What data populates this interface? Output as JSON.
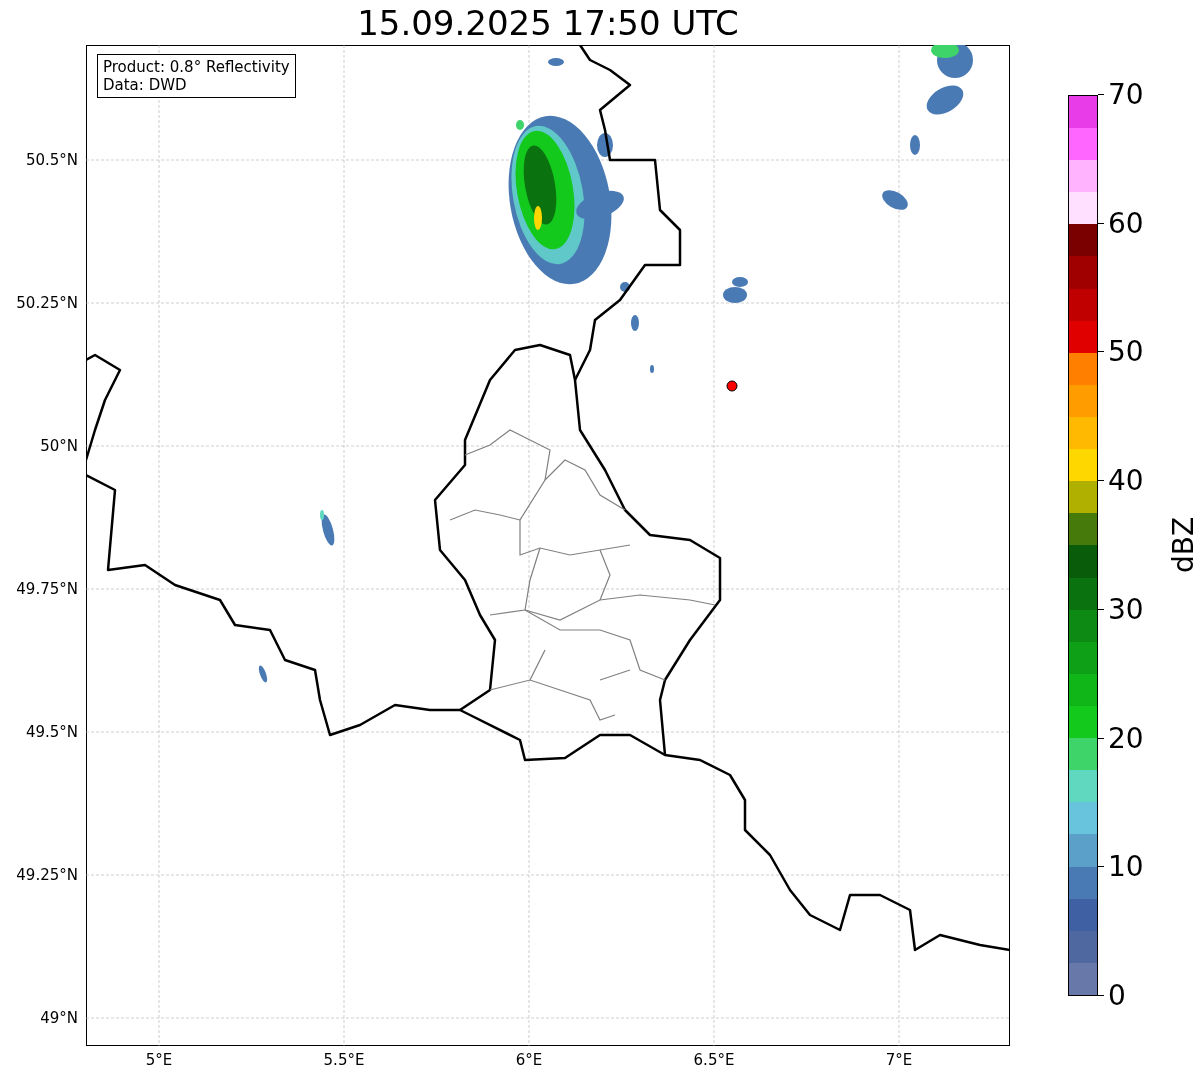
{
  "title": "15.09.2025 17:50 UTC",
  "legend": [
    "Product: 0.8° Reflectivity",
    "Data: DWD"
  ],
  "map": {
    "lat_labels": [
      "50.5°N",
      "50.25°N",
      "50°N",
      "49.75°N",
      "49.5°N",
      "49.25°N",
      "49°N"
    ],
    "lon_labels": [
      "5°E",
      "5.5°E",
      "6°E",
      "6.5°E",
      "7°E"
    ]
  },
  "colorbar": {
    "label": "dBZ",
    "ticks": [
      "70",
      "60",
      "50",
      "40",
      "30",
      "20",
      "10",
      "0"
    ],
    "segments": [
      {
        "color": "#6878a8"
      },
      {
        "color": "#5068a0"
      },
      {
        "color": "#4060a4"
      },
      {
        "color": "#4a7ab4"
      },
      {
        "color": "#5aa0c8"
      },
      {
        "color": "#68c4dc"
      },
      {
        "color": "#60d8c0"
      },
      {
        "color": "#3ed46a"
      },
      {
        "color": "#12c91c"
      },
      {
        "color": "#10b518"
      },
      {
        "color": "#0ea016"
      },
      {
        "color": "#0c8a14"
      },
      {
        "color": "#0a730f"
      },
      {
        "color": "#085c0a"
      },
      {
        "color": "#467a0a"
      },
      {
        "color": "#b0b000"
      },
      {
        "color": "#ffd700"
      },
      {
        "color": "#ffb900"
      },
      {
        "color": "#ff9c00"
      },
      {
        "color": "#ff8000"
      },
      {
        "color": "#e00000"
      },
      {
        "color": "#c00000"
      },
      {
        "color": "#a00000"
      },
      {
        "color": "#7a0000"
      },
      {
        "color": "#ffe0ff"
      },
      {
        "color": "#ffb3ff"
      },
      {
        "color": "#ff66ff"
      },
      {
        "color": "#e83ce8"
      }
    ]
  }
}
